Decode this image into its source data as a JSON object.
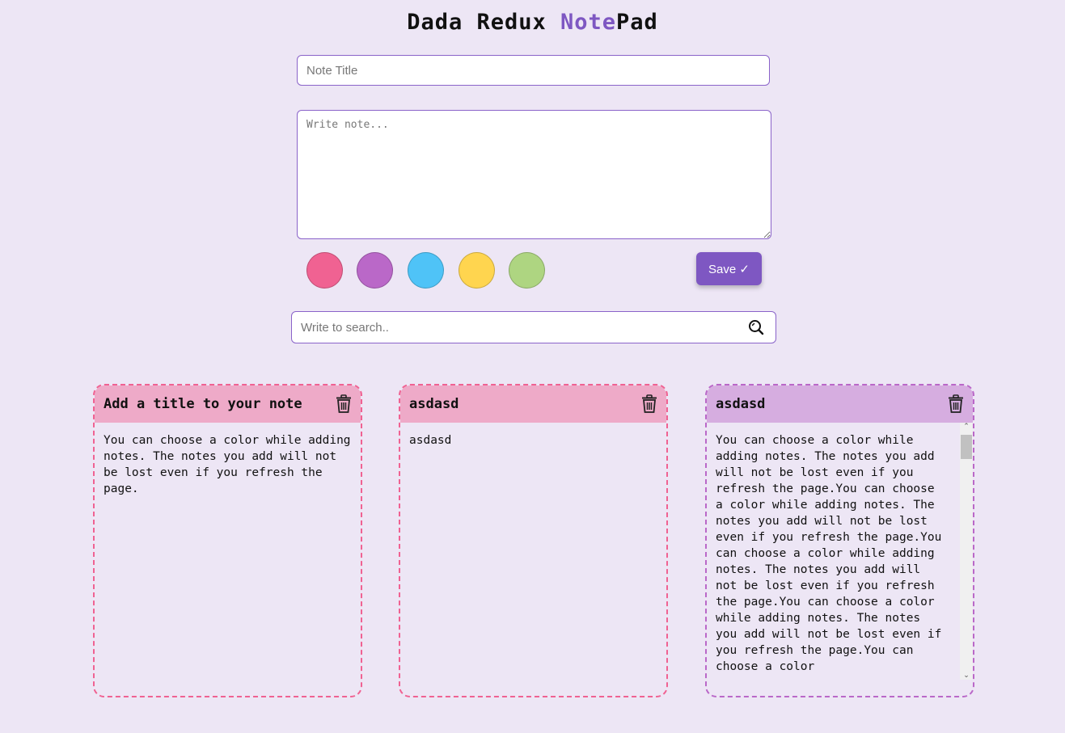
{
  "header": {
    "title_part1": "Dada Redux ",
    "title_accent": "Note",
    "title_part2": "Pad"
  },
  "form": {
    "title_placeholder": "Note Title",
    "body_placeholder": "Write note...",
    "save_label": "Save ✓"
  },
  "colors": [
    "#f06292",
    "#ba68c8",
    "#4fc3f7",
    "#ffd54f",
    "#aed581"
  ],
  "search": {
    "placeholder": "Write to search.."
  },
  "notes": [
    {
      "title": "Add a title to your note",
      "body": "You can choose a color while adding notes. The notes you add will not be lost even if you refresh the page.",
      "color": "#f06292"
    },
    {
      "title": "asdasd",
      "body": "asdasd",
      "color": "#f06292"
    },
    {
      "title": "asdasd",
      "body": "You can choose a color while adding notes. The notes you add will not be lost even if you refresh the page.You can choose a color while adding notes. The notes you add will not be lost even if you refresh the page.You can choose a color while adding notes. The notes you add will not be lost even if you refresh the page.You can choose a color while adding notes. The notes you add will not be lost even if you refresh the page.You can choose a color",
      "color": "#ba68c8"
    }
  ]
}
